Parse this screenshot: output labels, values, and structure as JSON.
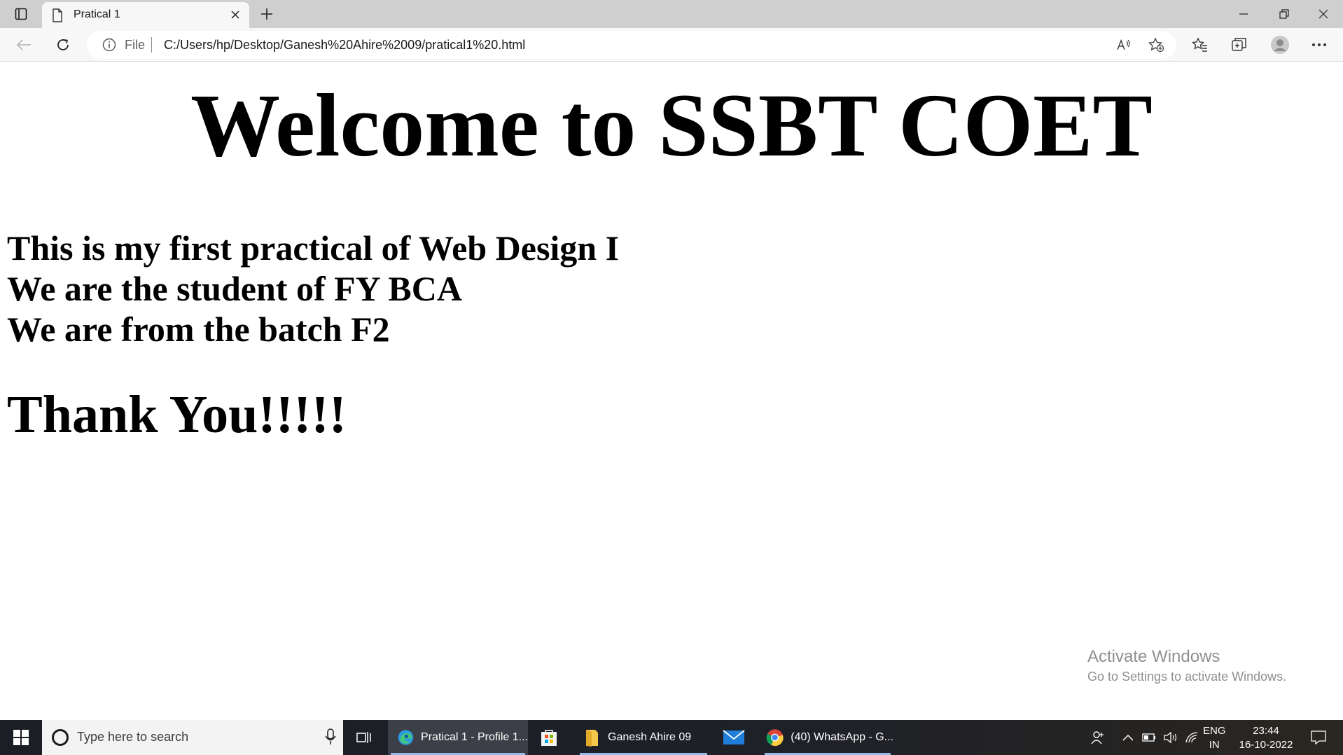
{
  "browser": {
    "tab_title": "Pratical 1",
    "address": {
      "scheme_label": "File",
      "url": "C:/Users/hp/Desktop/Ganesh%20Ahire%2009/pratical1%20.html"
    }
  },
  "page": {
    "heading": "Welcome to SSBT COET",
    "lines": [
      "This is my first practical of Web Design I",
      "We are the student of FY BCA",
      "We are from the batch F2"
    ],
    "thanks": "Thank You!!!!!",
    "watermark": {
      "title": "Activate Windows",
      "subtitle": "Go to Settings to activate Windows."
    }
  },
  "taskbar": {
    "search_placeholder": "Type here to search",
    "apps": [
      {
        "label": "Pratical 1 - Profile 1...",
        "icon": "edge-icon",
        "active": true
      },
      {
        "label": "",
        "icon": "store-icon"
      },
      {
        "label": "Ganesh Ahire 09",
        "icon": "folder-icon"
      },
      {
        "label": "",
        "icon": "mail-icon"
      },
      {
        "label": "(40) WhatsApp - G...",
        "icon": "chrome-icon"
      }
    ],
    "lang_top": "ENG",
    "lang_bottom": "IN",
    "time": "23:44",
    "date": "16-10-2022"
  },
  "colors": {
    "tabstrip": "#cfcfcf",
    "toolbar": "#f7f7f7",
    "taskbar": "#1f2128",
    "watermark": "#8f8f8f"
  }
}
